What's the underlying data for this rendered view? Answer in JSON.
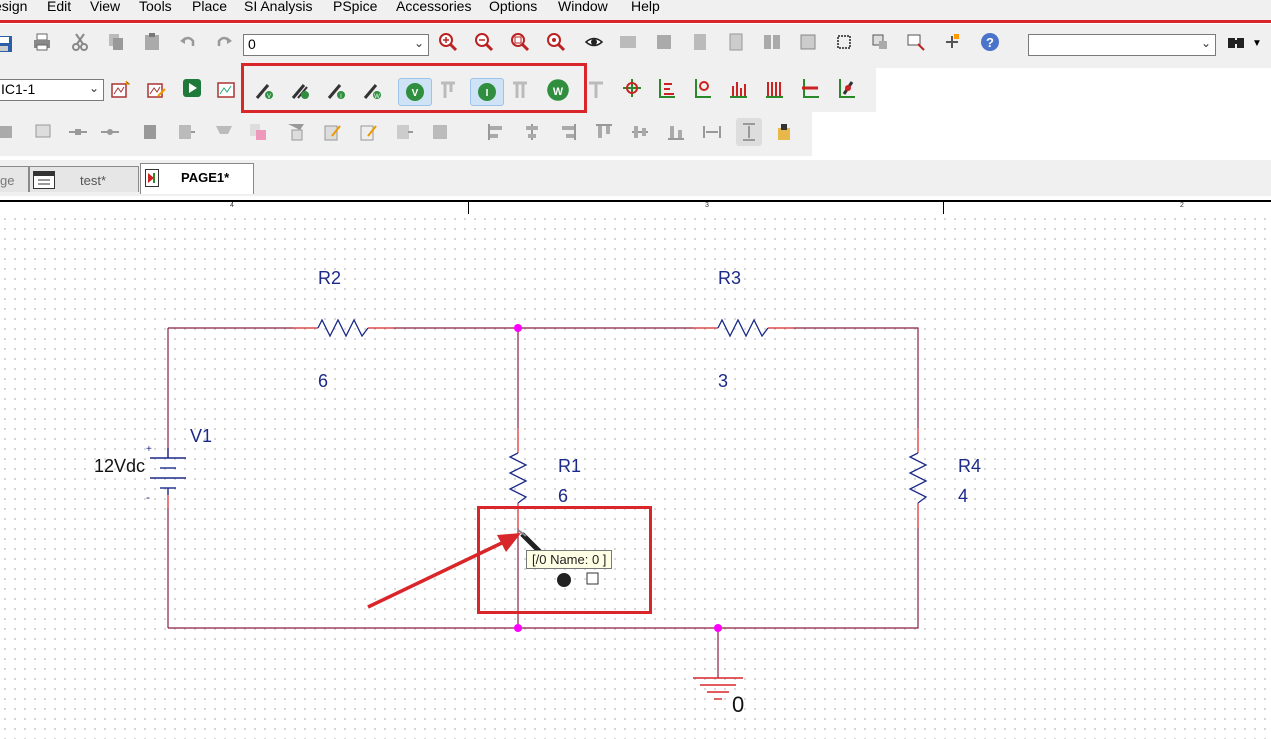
{
  "menu": {
    "items": [
      "esign",
      "Edit",
      "View",
      "Tools",
      "Place",
      "SI Analysis",
      "PSpice",
      "Accessories",
      "Options",
      "Window",
      "Help"
    ]
  },
  "toolbar": {
    "zoom_value": "0",
    "search_value": "",
    "profile_value": "IC1-1"
  },
  "tabs": [
    {
      "label": "ge"
    },
    {
      "label": "test*"
    },
    {
      "label": "PAGE1*"
    }
  ],
  "ruler": {
    "marks": [
      "4",
      "3",
      "2"
    ]
  },
  "schematic": {
    "components": [
      {
        "ref": "R2",
        "value": "6"
      },
      {
        "ref": "R3",
        "value": "3"
      },
      {
        "ref": "R1",
        "value": "6"
      },
      {
        "ref": "R4",
        "value": "4"
      },
      {
        "ref": "V1",
        "value": "12Vdc"
      }
    ],
    "ground_label": "0",
    "battery_plus": "+",
    "battery_minus": "-"
  },
  "tooltip": {
    "text": "[/0 Name: 0 ]"
  },
  "colors": {
    "wire": "#8b1e3f",
    "junction": "#ff00ff",
    "label": "#1b2a8a",
    "component": "#1b2a8a",
    "highlight": "#d9262a"
  },
  "icons": {
    "probe_icons": [
      "voltage-marker-icon",
      "voltage-diff-marker-icon",
      "current-marker-icon",
      "power-marker-icon",
      "bias-voltage-icon",
      "bias-current-icon",
      "bias-power-icon"
    ]
  }
}
